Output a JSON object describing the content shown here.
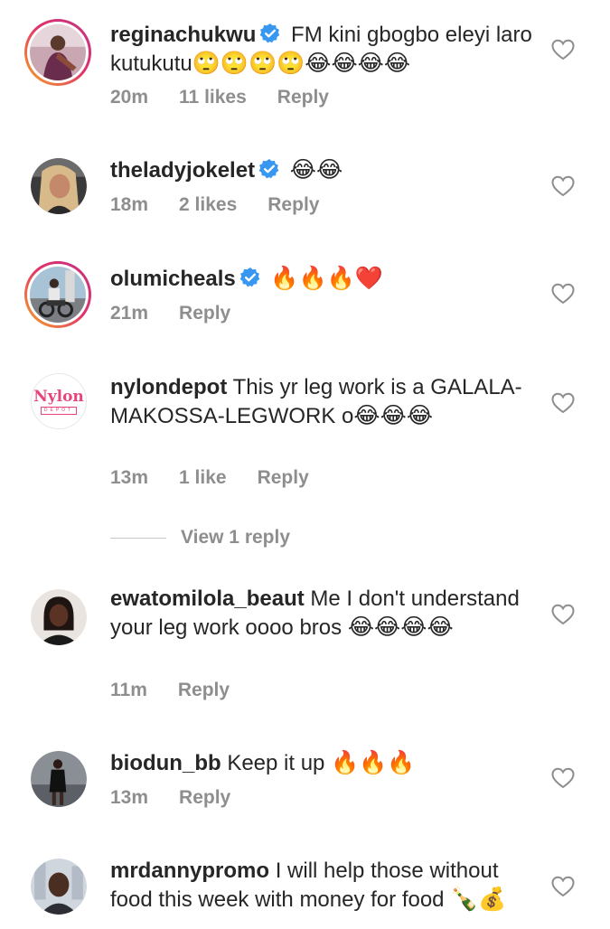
{
  "comments": [
    {
      "username": "reginachukwu",
      "verified": true,
      "text": "FM kini gbogbo eleyi laro kutukutu",
      "emoji": "🙄🙄🙄🙄😂😂😂😂",
      "time": "20m",
      "likes": "11 likes",
      "reply": "Reply"
    },
    {
      "username": "theladyjokelet",
      "verified": true,
      "text": "",
      "emoji": "😂😂",
      "time": "18m",
      "likes": "2 likes",
      "reply": "Reply"
    },
    {
      "username": "olumicheals",
      "verified": true,
      "text": "",
      "emoji": "🔥🔥🔥❤️",
      "time": "21m",
      "likes": "",
      "reply": "Reply"
    },
    {
      "username": "nylondepot",
      "verified": false,
      "text": "This yr leg work is a GALALA-MAKOSSA-LEGWORK o",
      "emoji": "😂😂😂",
      "time": "13m",
      "likes": "1 like",
      "reply": "Reply",
      "avatar_text": "Nylon",
      "avatar_subtext": "DEPOT"
    },
    {
      "username": "ewatomilola_beaut",
      "verified": false,
      "text": "Me I don't understand your leg work oooo bros",
      "emoji": "😂😂😂😂",
      "time": "11m",
      "likes": "",
      "reply": "Reply"
    },
    {
      "username": "biodun_bb",
      "verified": false,
      "text": "Keep it up",
      "emoji": "🔥🔥🔥",
      "time": "13m",
      "likes": "",
      "reply": "Reply"
    },
    {
      "username": "mrdannypromo",
      "verified": false,
      "text": "I will help those without food this week with money for food",
      "emoji": "🍾💰",
      "time": "",
      "likes": "",
      "reply": ""
    }
  ],
  "view_replies": "View 1 reply",
  "colors": {
    "text": "#262626",
    "meta": "#8e8e8e",
    "verified": "#3897f0",
    "story_ring_start": "#f5a623",
    "story_ring_end": "#c13584",
    "nylon_pink": "#e8457a"
  }
}
